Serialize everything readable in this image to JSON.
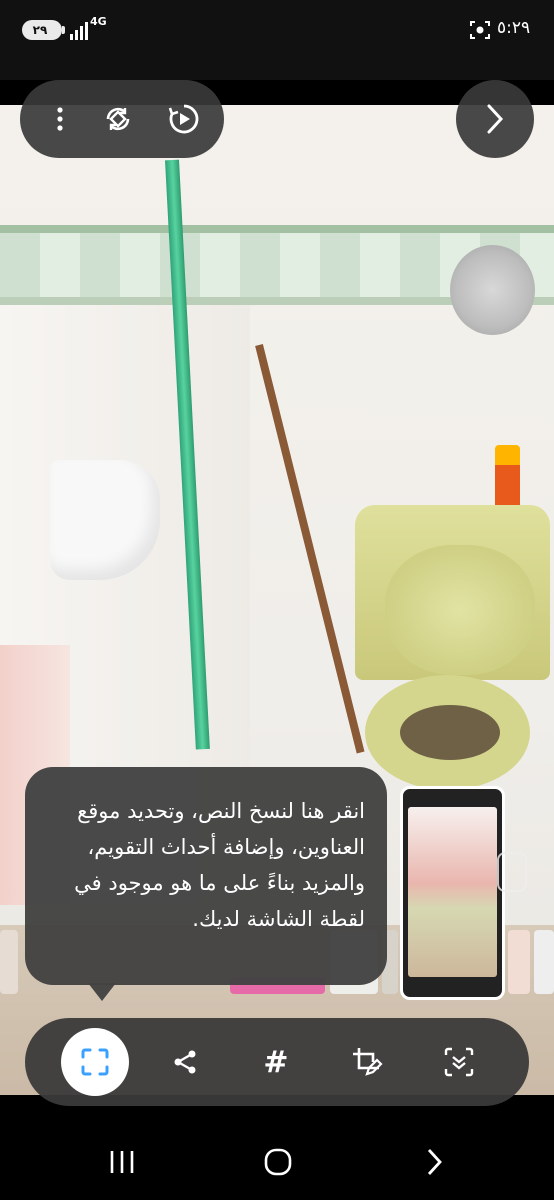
{
  "status_bar": {
    "battery": "٢٩",
    "network": "4G",
    "time": "٥:٢٩"
  },
  "top_controls": {
    "more_icon": "more-vert-icon",
    "rotate_icon": "rotate-icon",
    "replay_icon": "motion-play-icon",
    "next_icon": "chevron-right-icon"
  },
  "tooltip": {
    "text": "انقر هنا لنسخ النص، وتحديد موقع العناوين، وإضافة أحداث التقويم، والمزيد بناءً على ما هو موجود في لقطة الشاشة لديك."
  },
  "toolbar": {
    "tools": [
      {
        "icon": "scan-text-icon"
      },
      {
        "icon": "share-icon"
      },
      {
        "icon": "hashtag-icon",
        "label": "#"
      },
      {
        "icon": "crop-edit-icon"
      },
      {
        "icon": "scroll-capture-icon"
      }
    ]
  },
  "nav_bar": {
    "recents": "recents-icon",
    "home": "home-icon",
    "back": "back-icon"
  },
  "colors": {
    "overlay": "#3a3a3a",
    "accent_scan": "#3aa0ff"
  }
}
